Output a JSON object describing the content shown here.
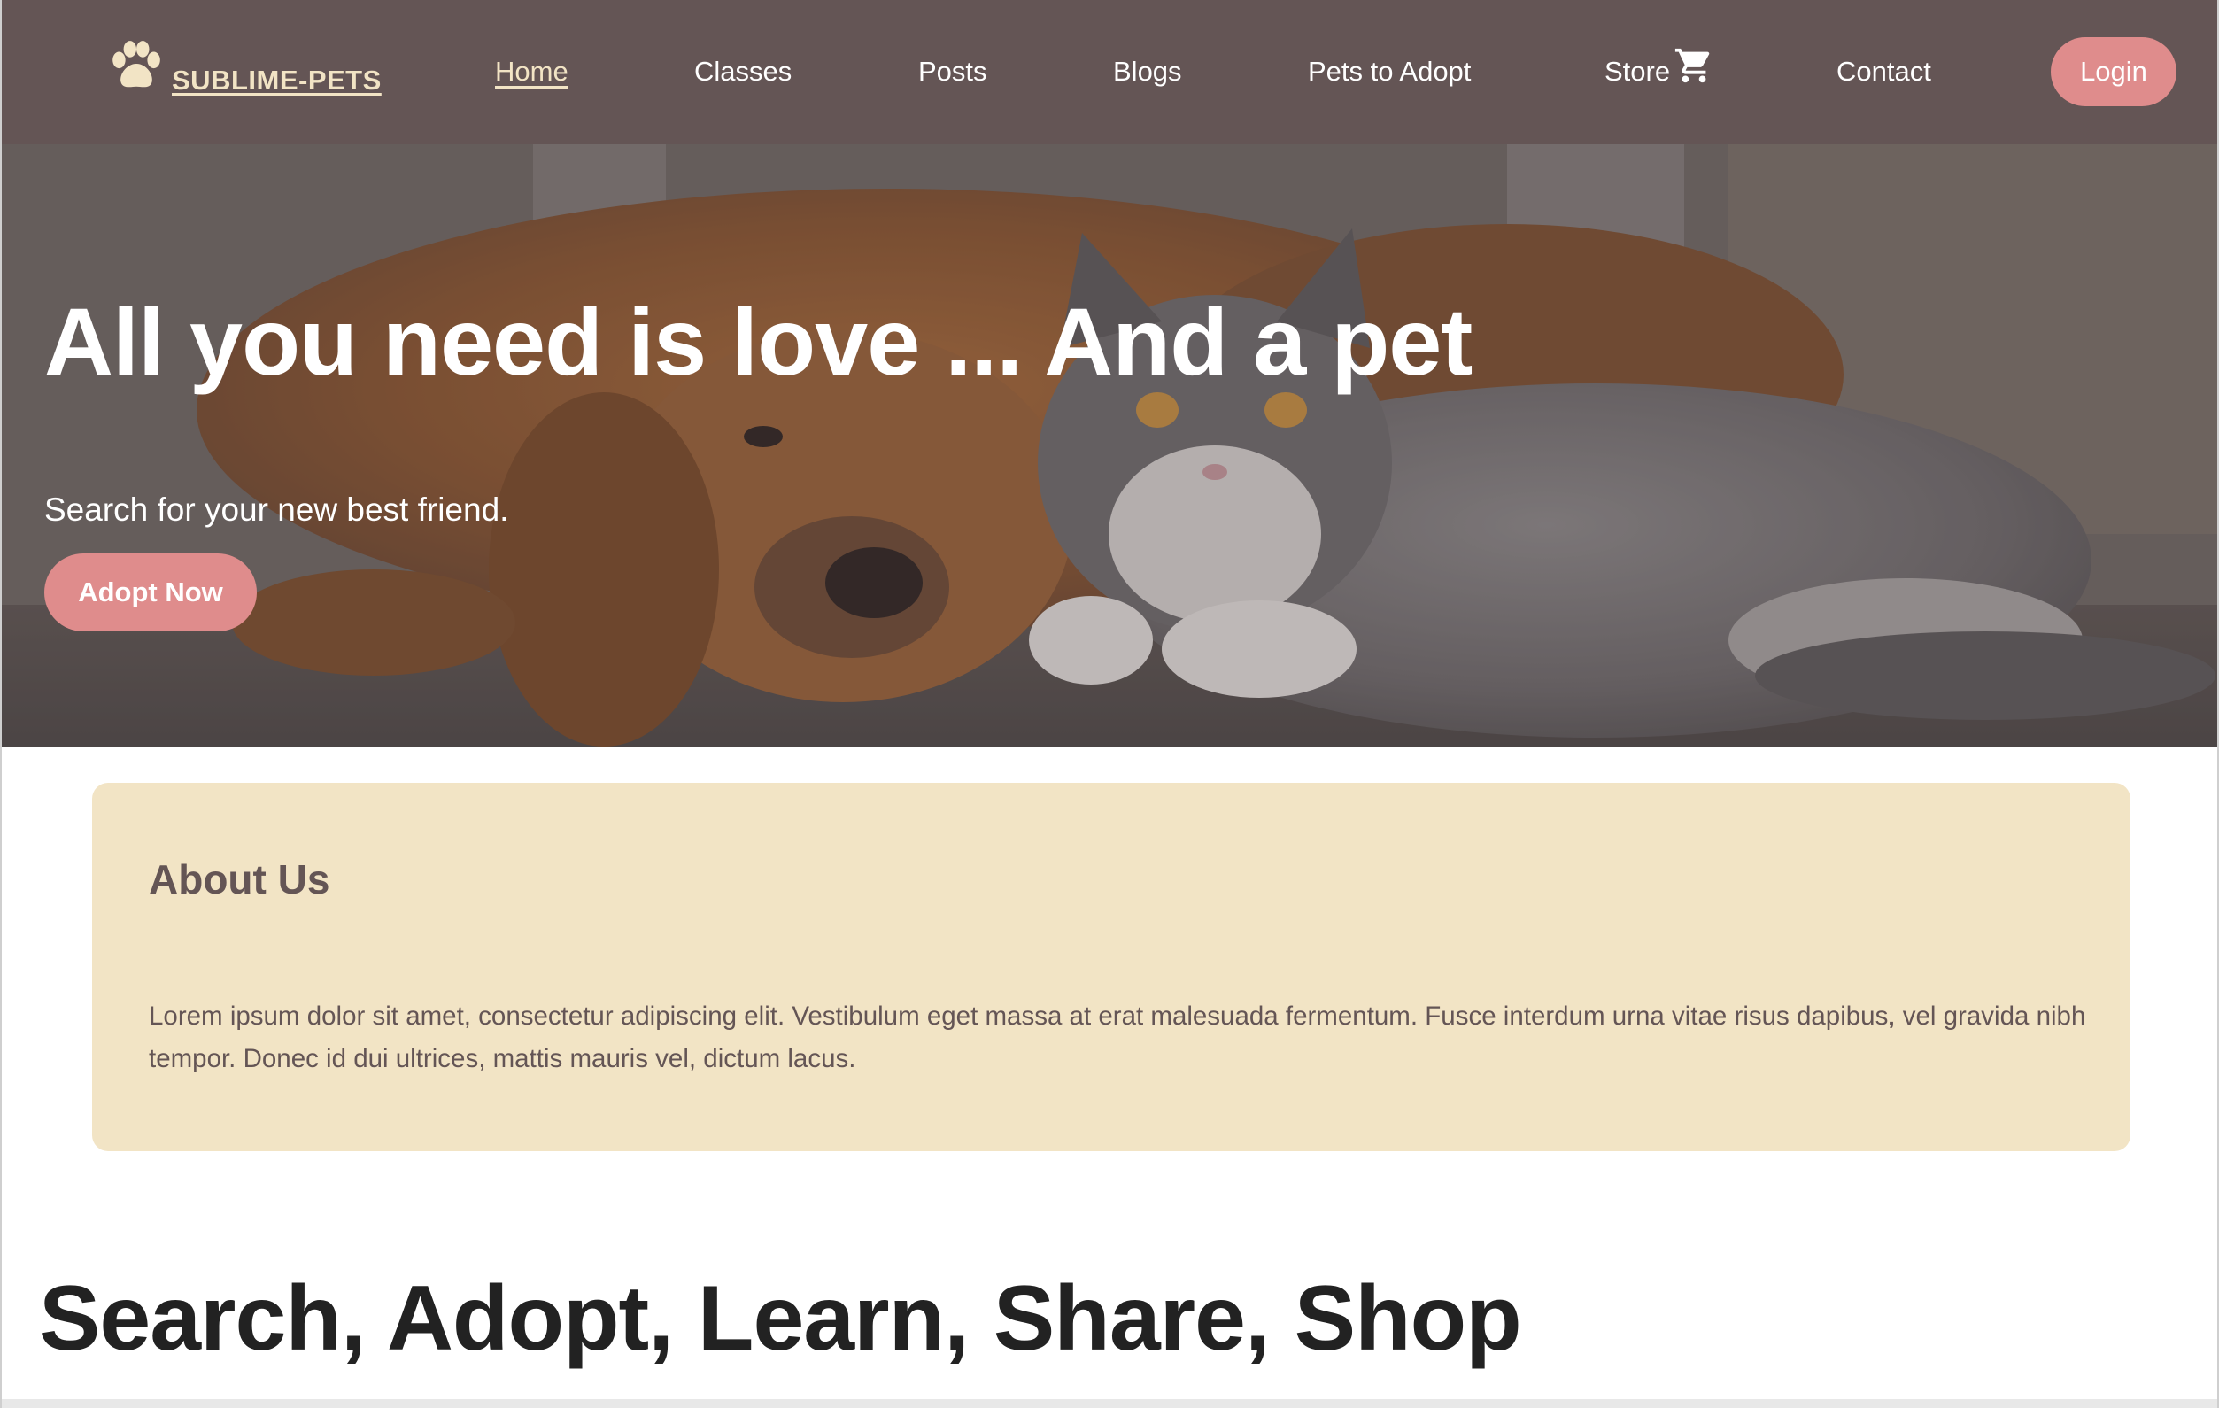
{
  "brand": {
    "name": "SUBLIME-PETS",
    "icon": "paw-icon",
    "color": "#f2e4c5"
  },
  "nav": {
    "items": [
      {
        "label": "Home",
        "active": true
      },
      {
        "label": "Classes"
      },
      {
        "label": "Posts"
      },
      {
        "label": "Blogs"
      },
      {
        "label": "Pets to Adopt"
      },
      {
        "label": "Store",
        "icon": "shopping-cart-icon"
      },
      {
        "label": "Contact"
      }
    ],
    "login_label": "Login"
  },
  "hero": {
    "title": "All you need is love ... And a pet",
    "subtitle": "Search for your new best friend.",
    "cta_label": "Adopt Now"
  },
  "about": {
    "title": "About Us",
    "text": "Lorem ipsum dolor sit amet, consectetur adipiscing elit. Vestibulum eget massa at erat malesuada fermentum. Fusce interdum urna vitae risus dapibus, vel gravida nibh tempor. Donec id dui ultrices, mattis mauris vel, dictum lacus."
  },
  "features": {
    "title": "Search, Adopt, Learn, Share, Shop"
  },
  "colors": {
    "navbar": "#645555",
    "accent": "#df8c8c",
    "cream": "#f2e4c5",
    "text_dark": "#222222"
  }
}
